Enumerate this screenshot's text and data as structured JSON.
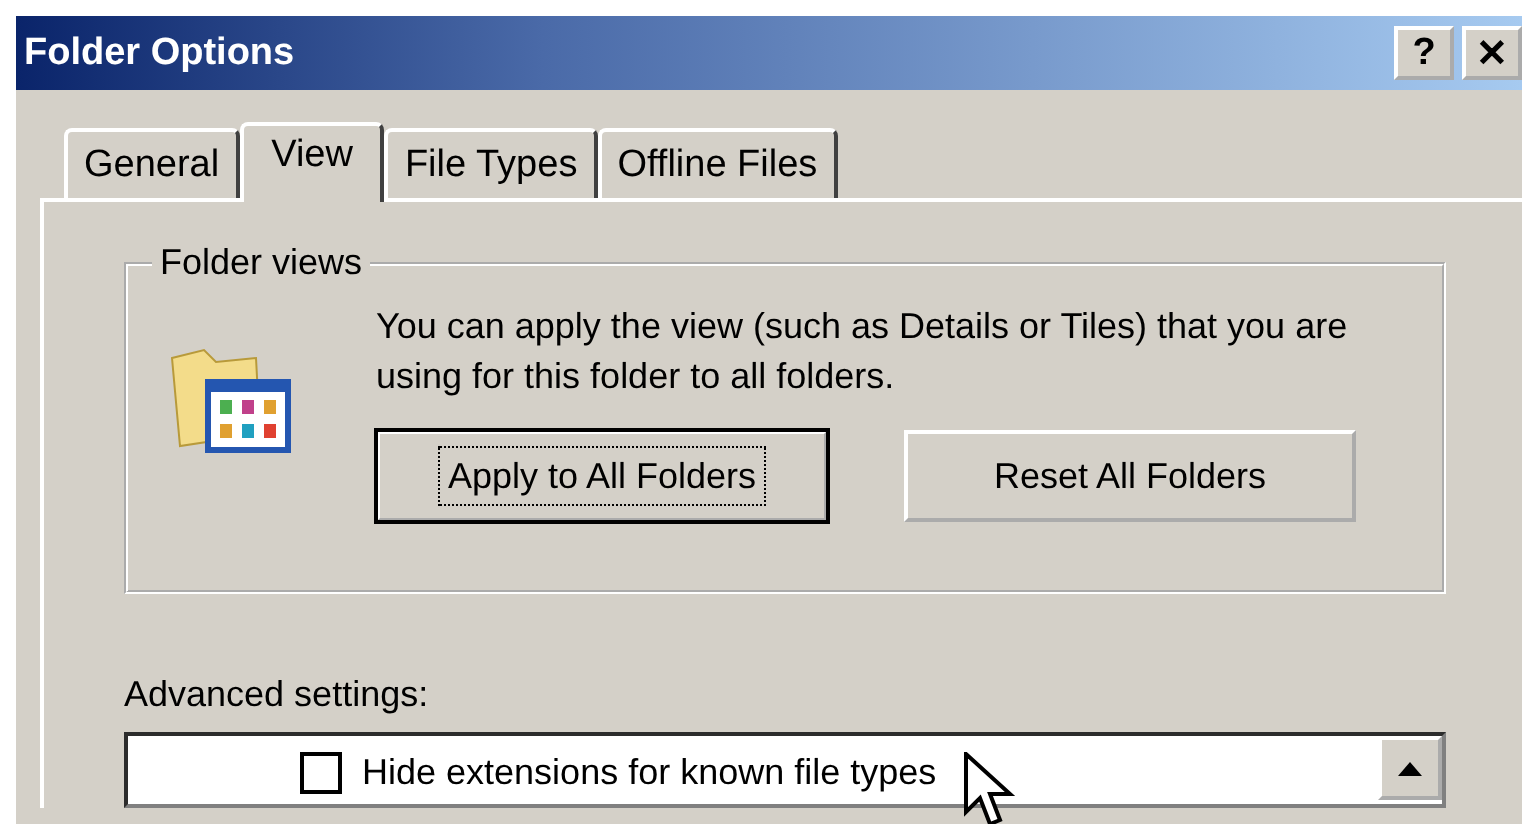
{
  "window": {
    "title": "Folder Options",
    "title_buttons": [
      "?",
      "✕"
    ]
  },
  "tabs": [
    {
      "label": "General",
      "selected": false
    },
    {
      "label": "View",
      "selected": true
    },
    {
      "label": "File Types",
      "selected": false
    },
    {
      "label": "Offline Files",
      "selected": false
    }
  ],
  "folder_views": {
    "heading": "Folder views",
    "description": "You can apply the view (such as Details or Tiles) that you are using for this folder to all folders.",
    "buttons": [
      {
        "label": "Apply to All Folders",
        "focused": true
      },
      {
        "label": "Reset All Folders",
        "focused": false
      }
    ]
  },
  "advanced_settings": {
    "label": "Advanced settings:",
    "items": [
      {
        "label": "Hide extensions for known file types",
        "checked": false
      }
    ]
  }
}
